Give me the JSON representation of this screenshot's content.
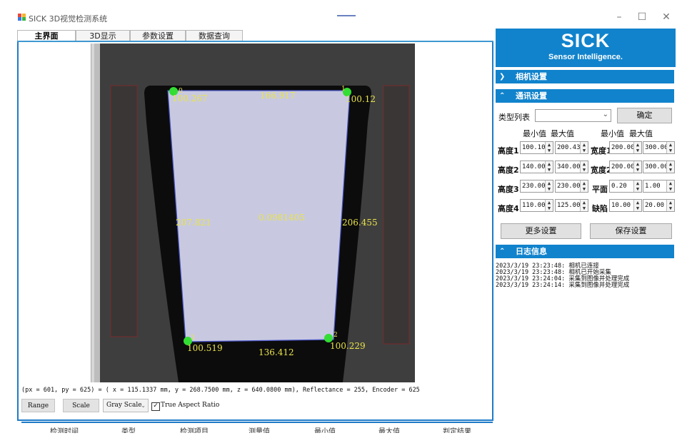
{
  "window": {
    "title": "SICK 3D视觉检测系统",
    "minimize": "–",
    "maximize": "☐",
    "close": "✕"
  },
  "tabs": [
    {
      "label": "主界面"
    },
    {
      "label": "3D显示"
    },
    {
      "label": "参数设置"
    },
    {
      "label": "数据查询"
    }
  ],
  "viewer": {
    "measurements": {
      "top": "166.917",
      "corner_tl": "100.267",
      "corner_tr": "100.12",
      "left": "207.821",
      "center": "0.0981405",
      "right": "206.455",
      "corner_bl": "100.519",
      "bottom": "136.412",
      "corner_br": "100.229"
    },
    "corner_ids": {
      "tl": "0",
      "tr": "1",
      "bl": "3",
      "br": "2"
    },
    "status": "(px = 601, py = 625) = ( x = 115.1337 mm, y = 268.7500 mm, z = 640.0800 mm), Reflectance = 255, Encoder = 625",
    "buttons": {
      "range": "Range",
      "scale": "Scale",
      "gray_scale": "Gray Scale",
      "true_aspect": "True Aspect Ratio",
      "true_aspect_checked": "✓"
    }
  },
  "grid": {
    "columns": [
      "检测时间",
      "类型",
      "检测项目",
      "测量值",
      "最小值",
      "最大值",
      "判定结果"
    ]
  },
  "right": {
    "logo": "SICK",
    "logo_sub": "Sensor Intelligence.",
    "camera_section": "相机设置",
    "comm_section": "通讯设置",
    "type_list_label": "类型列表",
    "type_selected": "",
    "confirm": "确定",
    "min_label": "最小值",
    "max_label": "最大值",
    "params_left": [
      {
        "label": "高度1",
        "min": "100.10",
        "max": "200.43"
      },
      {
        "label": "高度2",
        "min": "140.00",
        "max": "340.00"
      },
      {
        "label": "高度3",
        "min": "230.00",
        "max": "230.00"
      },
      {
        "label": "高度4",
        "min": "110.00",
        "max": "125.00"
      }
    ],
    "params_right": [
      {
        "label": "宽度1",
        "min": "200.00",
        "max": "300.00"
      },
      {
        "label": "宽度2",
        "min": "200.00",
        "max": "300.00"
      },
      {
        "label": "平面",
        "min": "0.20",
        "max": "1.00"
      },
      {
        "label": "缺陷",
        "min": "10.00",
        "max": "20.00"
      }
    ],
    "more_settings": "更多设置",
    "save_settings": "保存设置",
    "log_section": "日志信息",
    "logs": [
      "2023/3/19 23:23:48:  相机已连接",
      "2023/3/19 23:23:48:  相机已开始采集",
      "2023/3/19 23:24:04:  采集到图像并处理完成",
      "2023/3/19 23:24:14:  采集到图像并处理完成"
    ]
  },
  "colors": {
    "accent": "#1183cc",
    "overlay_text": "#e9e34a",
    "corner_marker": "#33dd33",
    "shape_fill": "#c7c8e0"
  }
}
